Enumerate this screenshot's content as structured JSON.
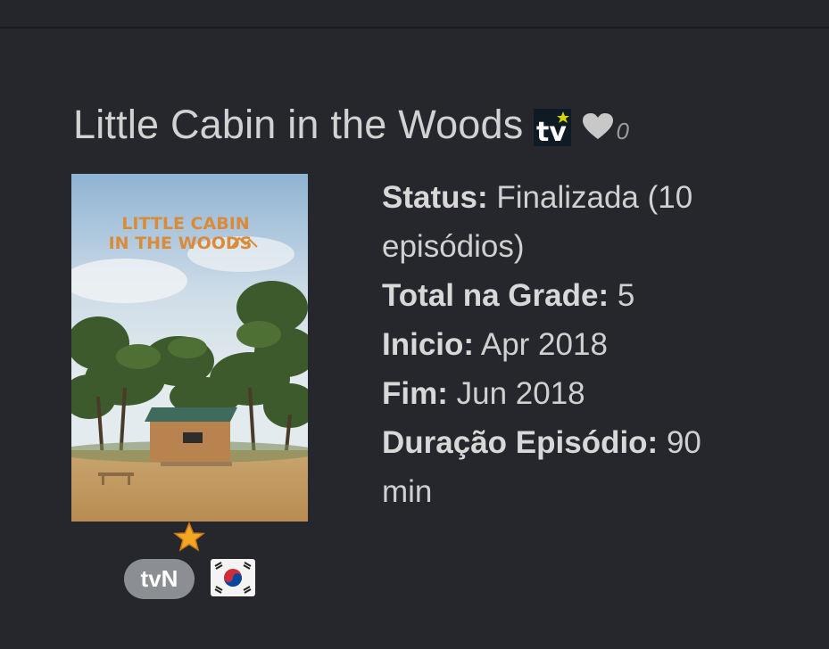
{
  "show": {
    "title": "Little Cabin in the Woods",
    "favorites_count": "0",
    "poster_title_line1": "LITTLE CABIN",
    "poster_title_line2": "IN THE WOODS",
    "network": "tvN",
    "country_flag": "south-korea-flag-icon",
    "rating_icon": "star-icon"
  },
  "info": {
    "status_label": "Status:",
    "status_value": "Finalizada (10 episódios)",
    "total_label": "Total na Grade:",
    "total_value": "5",
    "start_label": "Inicio:",
    "start_value": "Apr 2018",
    "end_label": "Fim:",
    "end_value": "Jun 2018",
    "duration_label": "Duração Episódio:",
    "duration_value": "90 min"
  },
  "colors": {
    "background": "#25272c",
    "badge": "#8b8e93",
    "star": "#f5a623",
    "poster_title": "#d98b3a"
  }
}
